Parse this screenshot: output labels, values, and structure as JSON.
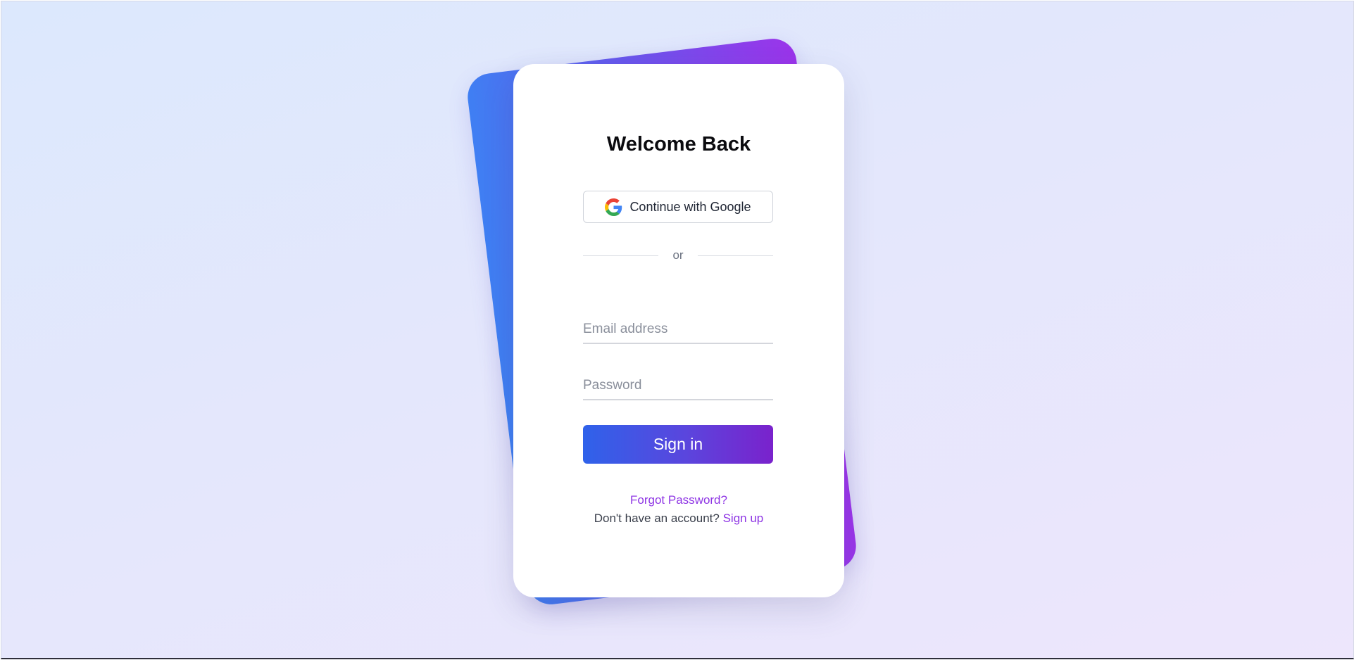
{
  "login": {
    "title": "Welcome Back",
    "google_button_label": "Continue with Google",
    "divider_text": "or",
    "email_placeholder": "Email address",
    "email_value": "",
    "password_placeholder": "Password",
    "password_value": "",
    "signin_label": "Sign in",
    "forgot_password": "Forgot Password?",
    "signup_prompt": "Don't have an account?",
    "signup_link": "Sign up"
  },
  "icons": {
    "google": "google-g-icon"
  },
  "colors": {
    "background_start": "#dce8fd",
    "background_end": "#ede6fc",
    "accent_blue": "#3f7ff3",
    "accent_purple": "#9b34ea",
    "button_start": "#2f62ea",
    "button_end": "#7a22cc",
    "link": "#8e35e4",
    "card": "#ffffff"
  }
}
